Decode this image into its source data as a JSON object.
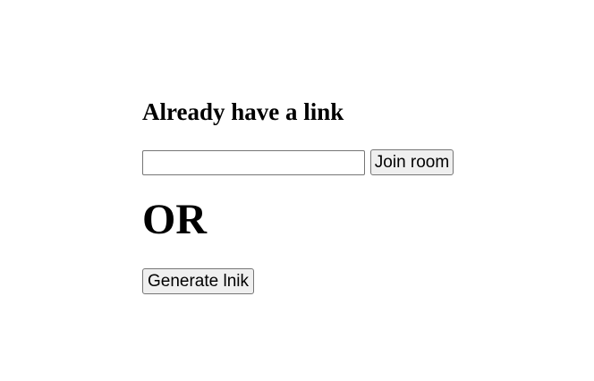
{
  "join_section": {
    "heading": "Already have a link",
    "input_value": "",
    "input_placeholder": "",
    "join_button_label": "Join room"
  },
  "divider_text": "OR",
  "generate_section": {
    "generate_button_label": "Generate lnik"
  }
}
